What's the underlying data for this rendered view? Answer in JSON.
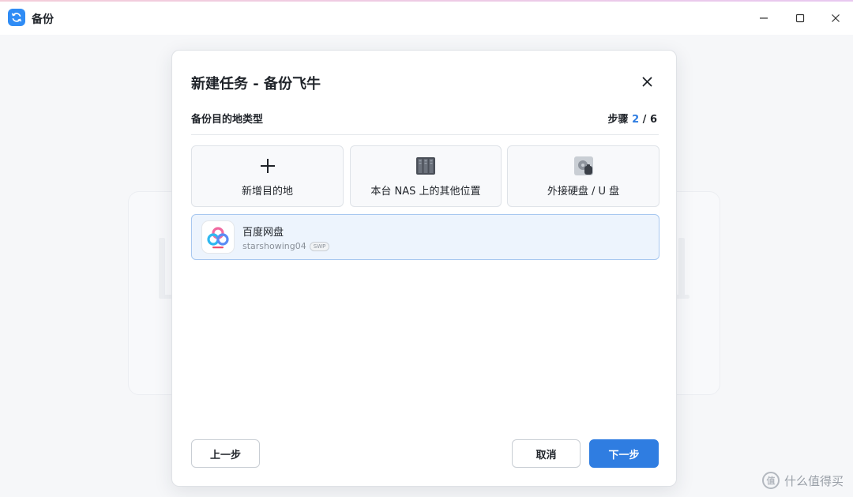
{
  "window": {
    "title": "备份",
    "app_icon": "backup-sync-icon",
    "controls": [
      "minimize-icon",
      "maximize-icon",
      "close-icon"
    ]
  },
  "dialog": {
    "title": "新建任务 - 备份飞牛",
    "section_label": "备份目的地类型",
    "step": {
      "prefix": "步骤",
      "current": "2",
      "separator": "/",
      "total": "6"
    },
    "destination_types": [
      {
        "label": "新增目的地",
        "icon": "plus-icon"
      },
      {
        "label": "本台 NAS 上的其他位置",
        "icon": "nas-server-icon"
      },
      {
        "label": "外接硬盘 / U 盘",
        "icon": "external-drive-icon"
      }
    ],
    "destinations": [
      {
        "name": "百度网盘",
        "account": "starshowing04",
        "badge": "SWP",
        "icon": "baidu-netdisk-icon",
        "selected": true
      }
    ],
    "buttons": {
      "prev": "上一步",
      "cancel": "取消",
      "next": "下一步"
    }
  },
  "watermark": {
    "text": "什么值得买",
    "icon": "smzdm-logo-icon",
    "icon_text": "值"
  },
  "colors": {
    "accent": "#2f7de1",
    "selected_bg": "#edf4fd",
    "selected_border": "#a8c8f0"
  }
}
